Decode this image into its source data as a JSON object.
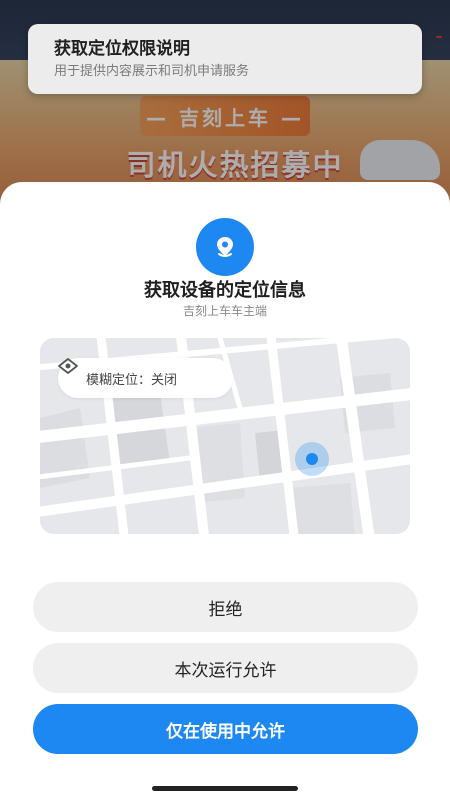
{
  "background": {
    "slogan": "— 吉刻上车 —",
    "headline": "司机火热招募中"
  },
  "notice": {
    "title": "获取定位权限说明",
    "description": "用于提供内容展示和司机申请服务"
  },
  "sheet": {
    "title": "获取设备的定位信息",
    "subtitle": "吉刻上车车主端",
    "approximate_location": "模糊定位：关闭",
    "buttons": {
      "deny": "拒绝",
      "allow_once": "本次运行允许",
      "allow_while_using": "仅在使用中允许"
    }
  },
  "colors": {
    "accent": "#1e88f2",
    "button_bg": "#efefef"
  }
}
